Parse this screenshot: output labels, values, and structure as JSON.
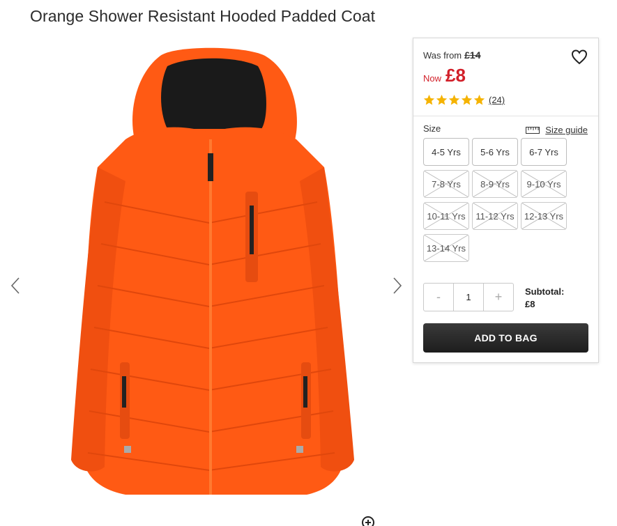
{
  "product": {
    "title": "Orange Shower Resistant Hooded Padded Coat"
  },
  "price": {
    "was_label": "Was from",
    "was_value": "£14",
    "now_label": "Now",
    "now_value": "£8"
  },
  "rating": {
    "stars": 5,
    "reviews": "(24)"
  },
  "size": {
    "label": "Size",
    "guide_label": "Size guide",
    "options": [
      {
        "label": "4-5 Yrs",
        "available": true
      },
      {
        "label": "5-6 Yrs",
        "available": true
      },
      {
        "label": "6-7 Yrs",
        "available": true
      },
      {
        "label": "7-8 Yrs",
        "available": false
      },
      {
        "label": "8-9 Yrs",
        "available": false
      },
      {
        "label": "9-10 Yrs",
        "available": false
      },
      {
        "label": "10-11 Yrs",
        "available": false
      },
      {
        "label": "11-12 Yrs",
        "available": false
      },
      {
        "label": "12-13 Yrs",
        "available": false
      },
      {
        "label": "13-14 Yrs",
        "available": false
      }
    ]
  },
  "quantity": {
    "minus": "-",
    "value": "1",
    "plus": "+"
  },
  "subtotal": {
    "label": "Subtotal:",
    "value": "£8"
  },
  "actions": {
    "add_to_bag": "ADD TO BAG"
  },
  "icons": {
    "prev": "chevron-left-icon",
    "next": "chevron-right-icon",
    "wishlist": "heart-icon",
    "zoom": "zoom-in-icon",
    "size_guide": "ruler-icon",
    "star": "star-icon"
  },
  "colors": {
    "sale_red": "#d21f29",
    "star_gold": "#f5b301",
    "button_dark": "#222222",
    "coat_orange": "#ff5a14"
  }
}
